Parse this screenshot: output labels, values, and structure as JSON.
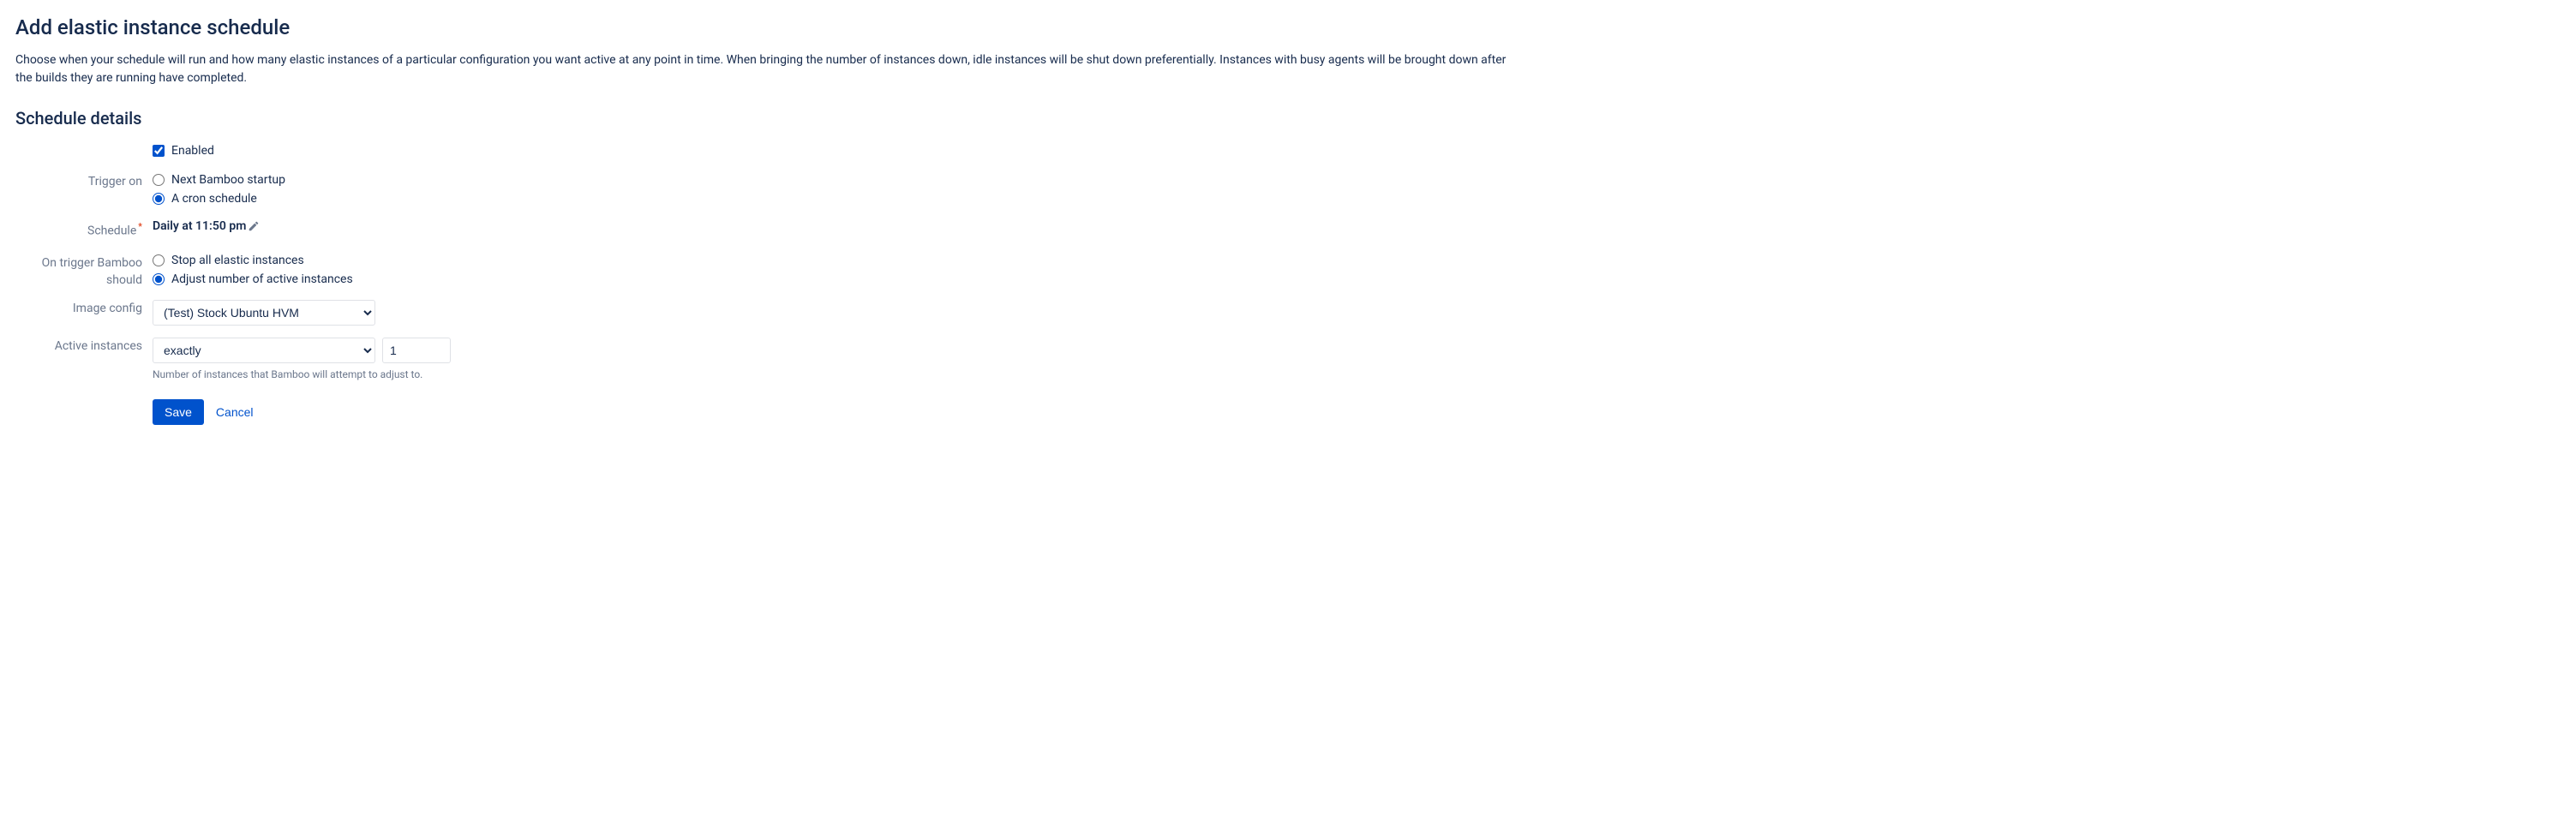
{
  "page": {
    "title": "Add elastic instance schedule",
    "description": "Choose when your schedule will run and how many elastic instances of a particular configuration you want active at any point in time. When bringing the number of instances down, idle instances will be shut down preferentially. Instances with busy agents will be brought down after the builds they are running have completed."
  },
  "section": {
    "heading": "Schedule details"
  },
  "form": {
    "enabled": {
      "label": "Enabled",
      "checked": true
    },
    "triggerOn": {
      "label": "Trigger on",
      "options": {
        "startup": "Next Bamboo startup",
        "cron": "A cron schedule"
      },
      "selected": "cron"
    },
    "schedule": {
      "label": "Schedule",
      "value": "Daily at 11:50 pm"
    },
    "onTrigger": {
      "label": "On trigger Bamboo should",
      "options": {
        "stop": "Stop all elastic instances",
        "adjust": "Adjust number of active instances"
      },
      "selected": "adjust"
    },
    "imageConfig": {
      "label": "Image config",
      "value": "(Test) Stock Ubuntu HVM"
    },
    "activeInstances": {
      "label": "Active instances",
      "mode": "exactly",
      "count": "1",
      "helpText": "Number of instances that Bamboo will attempt to adjust to."
    },
    "buttons": {
      "save": "Save",
      "cancel": "Cancel"
    }
  }
}
